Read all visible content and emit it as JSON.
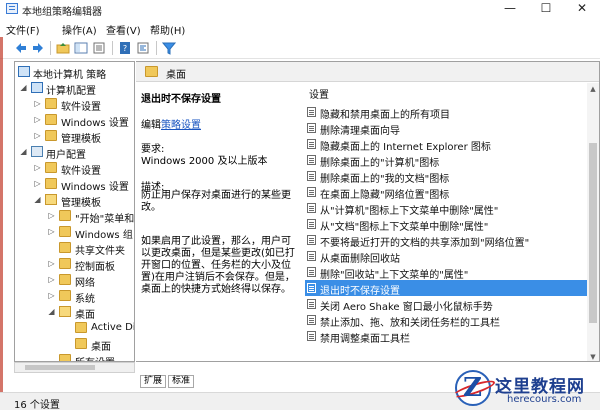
{
  "window": {
    "title": "本地组策略编辑器",
    "controls": {
      "minimize": "—",
      "maximize": "☐",
      "close": "✕"
    }
  },
  "menu": [
    "文件(F)",
    "操作(A)",
    "查看(V)",
    "帮助(H)"
  ],
  "toolbar": {
    "icons": [
      "back-icon",
      "forward-icon",
      "up-folder-icon",
      "show-tree-icon",
      "refresh-icon",
      "export-icon",
      "help-icon",
      "properties-icon",
      "filter-icon"
    ]
  },
  "tree": {
    "items": [
      {
        "label": "本地计算机 策略",
        "icon": "computer-policy-icon"
      },
      {
        "label": "计算机配置",
        "icon": "computer-icon"
      },
      {
        "label": "软件设置",
        "icon": "folder-icon"
      },
      {
        "label": "Windows 设置",
        "icon": "folder-icon"
      },
      {
        "label": "管理模板",
        "icon": "folder-icon"
      },
      {
        "label": "用户配置",
        "icon": "user-icon"
      },
      {
        "label": "软件设置",
        "icon": "folder-icon"
      },
      {
        "label": "Windows 设置",
        "icon": "folder-icon"
      },
      {
        "label": "管理模板",
        "icon": "folder-icon"
      },
      {
        "label": "\"开始\"菜单和",
        "icon": "folder-icon"
      },
      {
        "label": "Windows 组",
        "icon": "folder-icon"
      },
      {
        "label": "共享文件夹",
        "icon": "folder-icon"
      },
      {
        "label": "控制面板",
        "icon": "folder-icon"
      },
      {
        "label": "网络",
        "icon": "folder-icon"
      },
      {
        "label": "系统",
        "icon": "folder-icon"
      },
      {
        "label": "桌面",
        "icon": "folder-open-icon"
      },
      {
        "label": "Active Dir",
        "icon": "folder-icon"
      },
      {
        "label": "桌面",
        "icon": "folder-icon"
      },
      {
        "label": "所有设置",
        "icon": "folder-icon"
      }
    ]
  },
  "right": {
    "header": "桌面",
    "description": {
      "title": "退出时不保存设置",
      "edit_prefix": "编辑",
      "edit_link": "策略设置",
      "req_label": "要求:",
      "req_value": "Windows 2000 及以上版本",
      "desc_label": "描述:",
      "desc_text": "防止用户保存对桌面进行的某些更改。",
      "desc_text2": "如果启用了此设置，那么，用户可以更改桌面，但是某些更改(如已打开窗口的位置、任务栏的大小及位置)在用户注销后不会保存。但是，桌面上的快捷方式始终得以保存。"
    },
    "settings_header": "设置",
    "settings": [
      "隐藏和禁用桌面上的所有项目",
      "删除清理桌面向导",
      "隐藏桌面上的 Internet Explorer 图标",
      "删除桌面上的\"计算机\"图标",
      "删除桌面上的\"我的文档\"图标",
      "在桌面上隐藏\"网络位置\"图标",
      "从\"计算机\"图标上下文菜单中删除\"属性\"",
      "从\"文档\"图标上下文菜单中删除\"属性\"",
      "不要将最近打开的文档的共享添加到\"网络位置\"",
      "从桌面删除回收站",
      "删除\"回收站\"上下文菜单的\"属性\"",
      "退出时不保存设置",
      "关闭 Aero Shake 窗口最小化鼠标手势",
      "禁止添加、拖、放和关闭任务栏的工具栏",
      "禁用调整桌面工具栏"
    ],
    "selected_index": 11
  },
  "tabs": [
    "扩展",
    "标准"
  ],
  "status": "16 个设置",
  "watermark": {
    "logo": "Z",
    "text": "这里教程网",
    "sub": "herecours.com"
  },
  "colors": {
    "selection": "#3a8ee6",
    "link": "#1a55c0",
    "folder": "#f0c85a"
  }
}
